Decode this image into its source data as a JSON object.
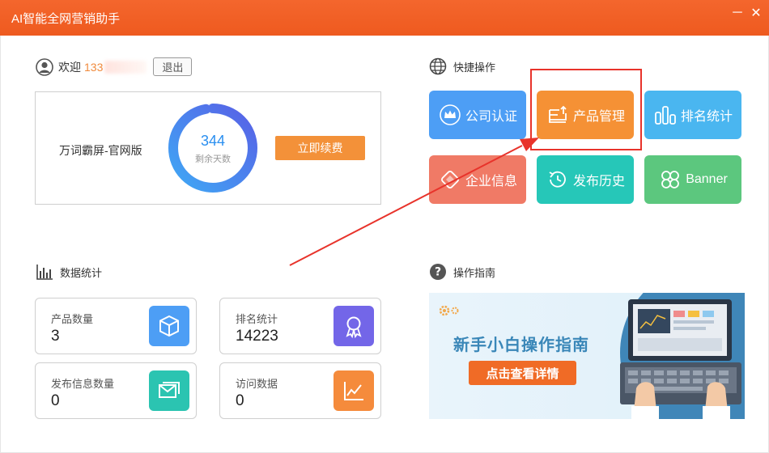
{
  "window": {
    "title": "AI智能全网营销助手",
    "minimize": "－",
    "close": "✕"
  },
  "account": {
    "welcome_label": "欢迎",
    "phone_visible": "133",
    "logout_label": "退出",
    "edition": "万词霸屏-官网版",
    "days_remaining": "344",
    "days_label": "剩余天数",
    "renew_label": "立即续费",
    "ring_fraction": 0.97
  },
  "stats": {
    "header": "数据统计",
    "cards": [
      {
        "label": "产品数量",
        "value": "3",
        "color": "#4d9ef5",
        "icon": "cube-icon"
      },
      {
        "label": "排名统计",
        "value": "14223",
        "color": "#7366e8",
        "icon": "award-icon"
      },
      {
        "label": "发布信息数量",
        "value": "0",
        "color": "#2bc4b1",
        "icon": "message-icon"
      },
      {
        "label": "访问数据",
        "value": "0",
        "color": "#f58b3c",
        "icon": "trend-chart-icon"
      }
    ]
  },
  "quick": {
    "header": "快捷操作",
    "tiles": [
      {
        "label": "公司认证",
        "color": "#4d9ef5",
        "icon": "crown-icon"
      },
      {
        "label": "产品管理",
        "color": "#f59135",
        "icon": "product-manage-icon"
      },
      {
        "label": "排名统计",
        "color": "#4ab6f0",
        "icon": "bar-stats-icon"
      },
      {
        "label": "企业信息",
        "color": "#f07a66",
        "icon": "enterprise-icon"
      },
      {
        "label": "发布历史",
        "color": "#26c7b8",
        "icon": "history-icon"
      },
      {
        "label": "Banner",
        "color": "#5cc77e",
        "icon": "banner-icon"
      }
    ]
  },
  "guide": {
    "header": "操作指南",
    "banner_title": "新手小白操作指南",
    "banner_button": "点击查看详情"
  }
}
